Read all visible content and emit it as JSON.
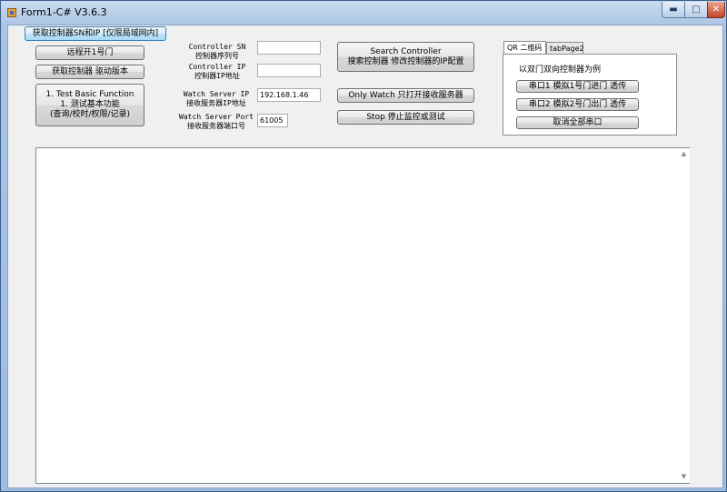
{
  "window": {
    "title": "Form1-C# V3.6.3",
    "controls": {
      "minimize": "▬",
      "maximize": "□",
      "close": "✕"
    }
  },
  "buttons": {
    "get_sn_ip": "获取控制器SN和IP  [仅限局域网内]",
    "remote_open": "远程开1号门",
    "get_driver_version": "获取控制器 驱动版本",
    "test_basic": [
      "1. Test Basic Function",
      "1. 测试基本功能",
      "(查询/校时/权限/记录)"
    ],
    "search_controller": [
      "Search Controller",
      "搜索控制器 修改控制器的IP配置"
    ],
    "only_watch": "Only Watch 只打开接收服务器",
    "stop": "Stop 停止监控或测试"
  },
  "fields": {
    "controller_sn": {
      "label": [
        "Controller SN",
        "控制器序列号"
      ],
      "value": ""
    },
    "controller_ip": {
      "label": [
        "Controller IP",
        "控制器IP地址"
      ],
      "value": ""
    },
    "watch_server_ip": {
      "label": [
        "Watch Server IP",
        "接收服务器IP地址"
      ],
      "value": "192.168.1.46"
    },
    "watch_server_port": {
      "label": [
        "Watch Server Port",
        "接收服务器端口号"
      ],
      "value": "61005"
    }
  },
  "tabs": {
    "items": [
      {
        "label": "QR 二维码",
        "active": true
      },
      {
        "label": "tabPage2",
        "active": false
      }
    ],
    "caption": "以双门双向控制器为例",
    "buttons": [
      "串口1 模拟1号门进门 透传",
      "串口2 模拟2号门出门 透传",
      "取消全部串口"
    ]
  },
  "output": {
    "text": ""
  }
}
